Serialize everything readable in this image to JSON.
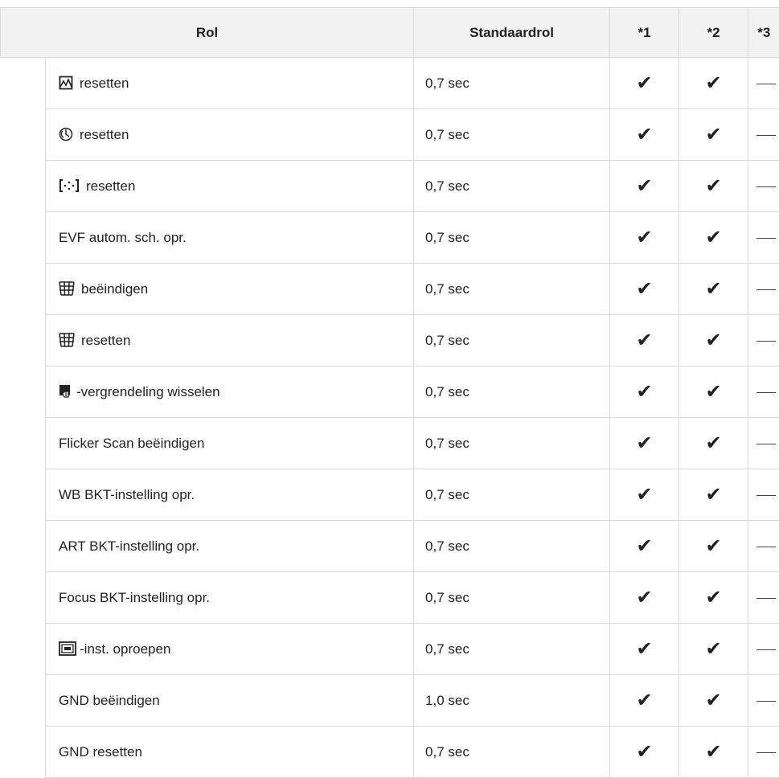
{
  "header": {
    "role": "Rol",
    "default_role": "Standaardrol",
    "col1": "*1",
    "col2": "*2",
    "col3": "*3"
  },
  "check_glyph": "✔",
  "rows": [
    {
      "icon": "histogram-icon",
      "label": "resetten",
      "default": "0,7 sec"
    },
    {
      "icon": "self-timer-icon",
      "label": "resetten",
      "default": "0,7 sec"
    },
    {
      "icon": "af-target-icon",
      "label": "resetten",
      "default": "0,7 sec"
    },
    {
      "icon": "",
      "label": "EVF autom. sch. opr.",
      "default": "0,7 sec"
    },
    {
      "icon": "grid-icon",
      "label": "beëindigen",
      "default": "0,7 sec"
    },
    {
      "icon": "grid-icon",
      "label": "resetten",
      "default": "0,7 sec"
    },
    {
      "icon": "touch-lock-icon",
      "label": "-vergrendeling wisselen",
      "default": "0,7 sec"
    },
    {
      "icon": "",
      "label": "Flicker Scan beëindigen",
      "default": "0,7 sec"
    },
    {
      "icon": "",
      "label": "WB BKT-instelling opr.",
      "default": "0,7 sec"
    },
    {
      "icon": "",
      "label": "ART BKT-instelling opr.",
      "default": "0,7 sec"
    },
    {
      "icon": "",
      "label": "Focus BKT-instelling opr.",
      "default": "0,7 sec"
    },
    {
      "icon": "frame-icon",
      "label": "-inst. oproepen",
      "default": "0,7 sec"
    },
    {
      "icon": "",
      "label": "GND beëindigen",
      "default": "1,0 sec"
    },
    {
      "icon": "",
      "label": "GND resetten",
      "default": "0,7 sec"
    }
  ]
}
